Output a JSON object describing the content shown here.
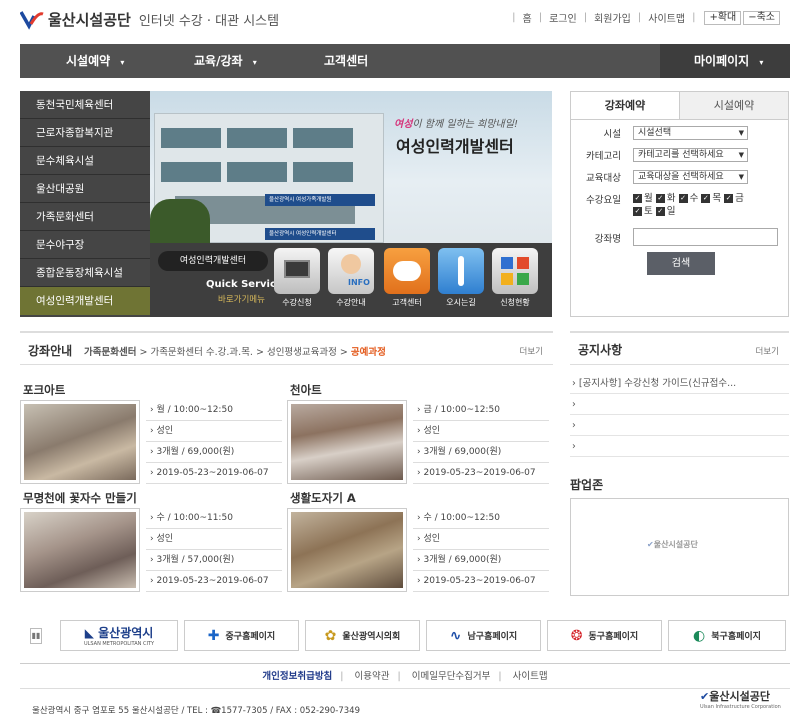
{
  "header": {
    "org_name": "울산시설공단",
    "system_name": "인터넷 수강 · 대관 시스템",
    "util": [
      "홈",
      "로그인",
      "회원가입",
      "사이트맵"
    ],
    "zoom_in": "+확대",
    "zoom_out": "−축소"
  },
  "gnb": [
    "시설예약",
    "교육/강좌",
    "고객센터",
    "마이페이지"
  ],
  "side_menu": [
    "동천국민체육센터",
    "근로자종합복지관",
    "문수체육시설",
    "울산대공원",
    "가족문화센터",
    "문수야구장",
    "종합운동장체육시설",
    "여성인력개발센터"
  ],
  "banner": {
    "slogan_em": "여성",
    "slogan_rest": "이 함께 일하는 희망내일!",
    "title": "여성인력개발센터",
    "sign1": "울산광역시 여성가족개발원",
    "sign2": "울산광역시 여성인력개발센터",
    "pill": "여성인력개발센터",
    "qs_title": "Quick Service",
    "qs_sub": "바로가기메뉴",
    "quick": [
      "수강신청",
      "수강안내",
      "고객센터",
      "오시는길",
      "신청현황"
    ]
  },
  "booking": {
    "tabs": [
      "강좌예약",
      "시설예약"
    ],
    "labels": [
      "시설",
      "카테고리",
      "교육대상",
      "수강요일",
      "강좌명"
    ],
    "facility": "시설선택",
    "category": "카테고리를 선택하세요",
    "target": "교육대상을 선택하세요",
    "days1": [
      "월",
      "화",
      "수",
      "목",
      "금"
    ],
    "days2": [
      "토",
      "일"
    ],
    "search": "검색"
  },
  "course": {
    "title": "강좌안내",
    "bc1": "가족문화센터",
    "bc2": "가족문화센터 수.강.과.목.",
    "bc3": "성인평생교육과정",
    "bc4": "공예과정",
    "more": "더보기",
    "items": [
      {
        "title": "포크아트",
        "time": "월 / 10:00~12:50",
        "target": "성인",
        "fee": "3개월 / 69,000(원)",
        "period": "2019-05-23~2019-06-07"
      },
      {
        "title": "천아트",
        "time": "금 / 10:00~12:50",
        "target": "성인",
        "fee": "3개월 / 69,000(원)",
        "period": "2019-05-23~2019-06-07"
      },
      {
        "title": "무명천에 꽃자수 만들기",
        "time": "수 / 10:00~11:50",
        "target": "성인",
        "fee": "3개월 / 57,000(원)",
        "period": "2019-05-23~2019-06-07"
      },
      {
        "title": "생활도자기 A",
        "time": "수 / 10:00~12:50",
        "target": "성인",
        "fee": "3개월 / 69,000(원)",
        "period": "2019-05-23~2019-06-07"
      }
    ]
  },
  "notice": {
    "title": "공지사항",
    "more": "더보기",
    "items": [
      "[공지사항] 수강신청 가이드(신규접수..."
    ]
  },
  "popup": {
    "title": "팝업존",
    "logo": "울산시설공단"
  },
  "links": [
    "울산광역시",
    "중구홈페이지",
    "울산광역시의회",
    "남구홈페이지",
    "동구홈페이지",
    "북구홈페이지"
  ],
  "links_sub": "ULSAN METROPOLITAN CITY",
  "footer": {
    "nav": [
      "개인정보취급방침",
      "이용약관",
      "이메일무단수집거부",
      "사이트맵"
    ],
    "address": "울산광역시 중구 염포로 55 울산시설공단 / TEL : ☎1577-7305 / FAX : 052-290-7349",
    "logo": "울산시설공단",
    "logo_sub": "Ulsan Infrastructure Corporation"
  },
  "colors": {
    "nav": "#515151",
    "side": "#454545",
    "side_active": "#6f7434",
    "accent": "#e35a1c"
  }
}
